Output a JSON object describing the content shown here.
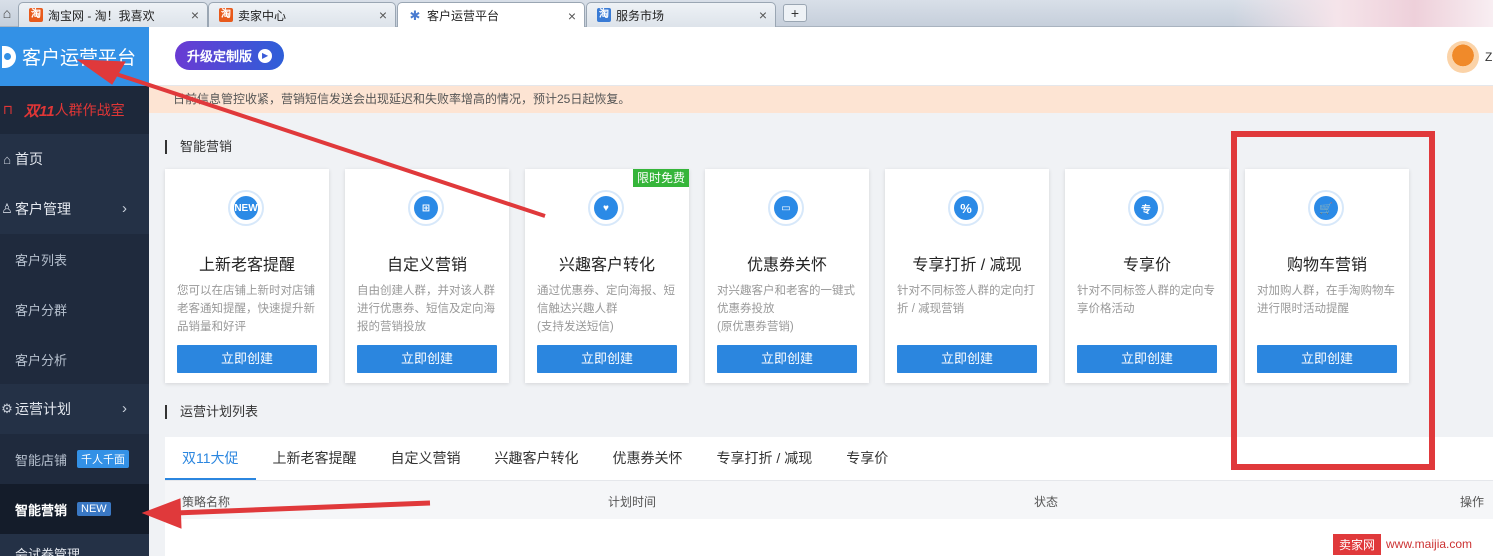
{
  "browser": {
    "tabs": [
      {
        "label": "淘宝网 - 淘！我喜欢",
        "favicon": "taobao-icon"
      },
      {
        "label": "卖家中心",
        "favicon": "taobao-icon"
      },
      {
        "label": "客户运营平台",
        "favicon": "loading-icon"
      },
      {
        "label": "服务市场",
        "favicon": "taobao-icon"
      }
    ],
    "close_glyph": "×",
    "newtab_glyph": "+",
    "home_glyph": "⌂"
  },
  "sidebar": {
    "brand": "客户运营平台",
    "promo": {
      "flag_glyph": "⊓",
      "highlight": "双11",
      "rest": "人群作战室"
    },
    "items": [
      {
        "label": "首页",
        "icon": "home-icon"
      },
      {
        "label": "客户管理",
        "icon": "person-icon"
      },
      {
        "label": "客户列表"
      },
      {
        "label": "客户分群"
      },
      {
        "label": "客户分析"
      },
      {
        "label": "运营计划",
        "icon": "gear-icon"
      },
      {
        "label": "智能店铺",
        "badge": "千人千面"
      },
      {
        "label": "智能营销",
        "badge": "NEW"
      },
      {
        "label": "会试卷管理"
      }
    ],
    "chevron": "›"
  },
  "topbar": {
    "upgrade_label": "升级定制版",
    "user_initial": "Z"
  },
  "notice": "日前信息管控收紧，营销短信发送会出现延迟和失败率增高的情况，预计25日起恢复。",
  "smart_marketing": {
    "title": "智能营销",
    "button_label": "立即创建",
    "free_tag": "限时免费",
    "cards": [
      {
        "title": "上新老客提醒",
        "desc": "您可以在店铺上新时对店铺老客通知提醒，快速提升新品销量和好评",
        "icon_text": "NEW",
        "icon": "new-icon"
      },
      {
        "title": "自定义营销",
        "desc": "自由创建人群，并对该人群进行优惠券、短信及定向海报的营销投放",
        "icon_text": "⊞",
        "icon": "gift-icon"
      },
      {
        "title": "兴趣客户转化",
        "desc": "通过优惠券、定向海报、短信触达兴趣人群\n(支持发送短信)",
        "icon_text": "♥",
        "icon": "heart-icon"
      },
      {
        "title": "优惠券关怀",
        "desc": "对兴趣客户和老客的一键式优惠券投放\n(原优惠券营销)",
        "icon_text": "▭",
        "icon": "coupon-icon"
      },
      {
        "title": "专享打折 / 减现",
        "desc": "针对不同标签人群的定向打折 / 减现营销",
        "icon_text": "%",
        "icon": "percent-icon"
      },
      {
        "title": "专享价",
        "desc": "针对不同标签人群的定向专享价格活动",
        "icon_text": "专",
        "icon": "exclusive-price-icon"
      },
      {
        "title": "购物车营销",
        "desc": "对加购人群，在手淘购物车进行限时活动提醒",
        "icon_text": "🛒",
        "icon": "cart-icon"
      }
    ]
  },
  "plan_list": {
    "title": "运营计划列表",
    "tabs": [
      "双11大促",
      "上新老客提醒",
      "自定义营销",
      "兴趣客户转化",
      "优惠券关怀",
      "专享打折 / 减现",
      "专享价"
    ],
    "columns": [
      "策略名称",
      "计划时间",
      "状态",
      "操作"
    ]
  },
  "watermark": {
    "brand": "卖家网",
    "url": "www.maijia.com"
  },
  "colors": {
    "accent": "#2b86df",
    "sidebar": "#243146",
    "annotation": "#e0393b",
    "notice_bg": "#fde4d3",
    "free_tag": "#35b53a"
  }
}
